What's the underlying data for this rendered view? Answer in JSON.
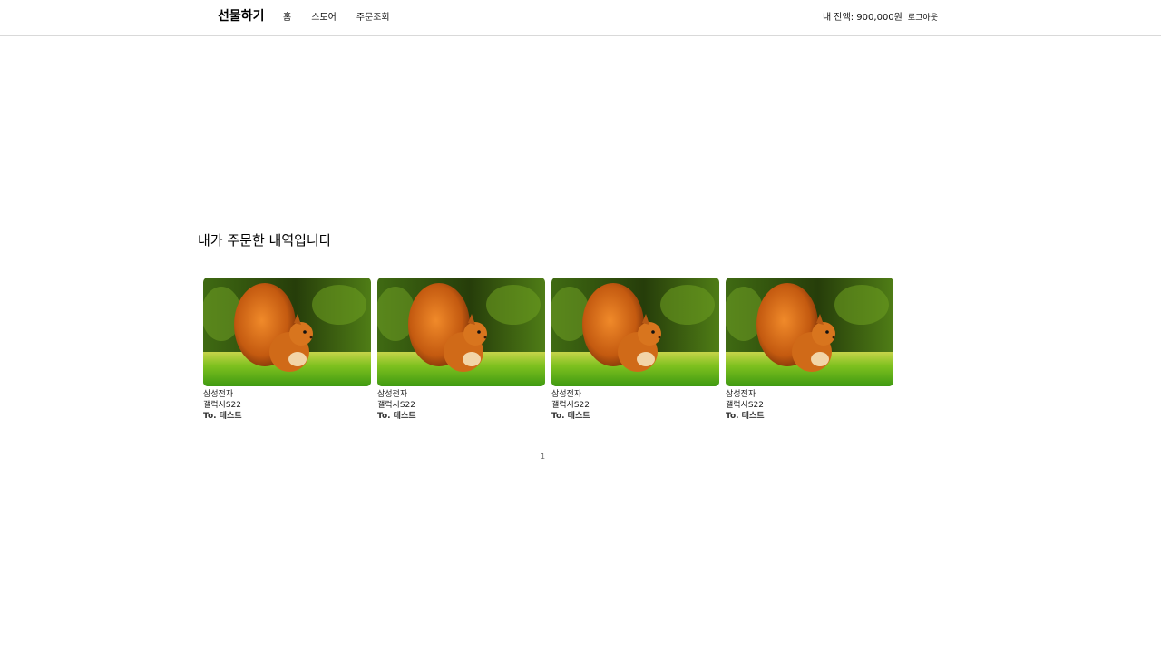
{
  "header": {
    "brand": "선물하기",
    "nav": [
      "홈",
      "스토어",
      "주문조회"
    ],
    "balance": "내 잔액: 900,000원",
    "logout": "로그아웃"
  },
  "main": {
    "heading": "내가 주문한 내역입니다",
    "orders": [
      {
        "brand": "삼성전자",
        "product": "갤럭시S22",
        "recipient": "To. 테스트",
        "image": "squirrel-photo"
      },
      {
        "brand": "삼성전자",
        "product": "갤럭시S22",
        "recipient": "To. 테스트",
        "image": "squirrel-photo"
      },
      {
        "brand": "삼성전자",
        "product": "갤럭시S22",
        "recipient": "To. 테스트",
        "image": "squirrel-photo"
      },
      {
        "brand": "삼성전자",
        "product": "갤럭시S22",
        "recipient": "To. 테스트",
        "image": "squirrel-photo"
      }
    ],
    "pagination": {
      "pages": [
        "1"
      ],
      "current": "1"
    }
  }
}
